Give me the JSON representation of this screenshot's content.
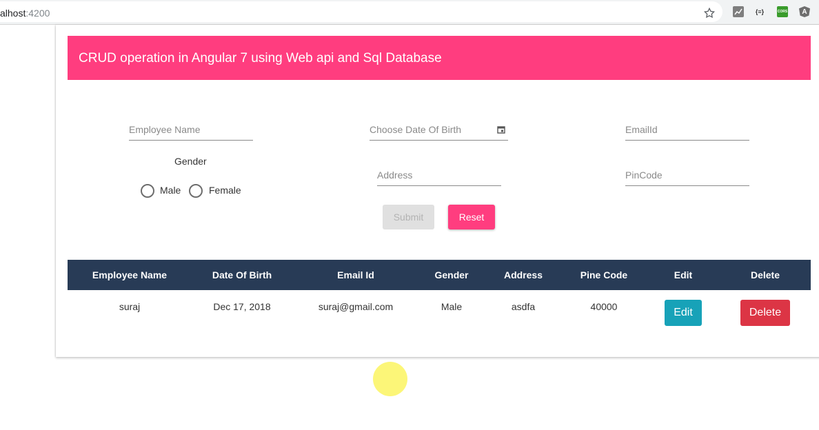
{
  "browser": {
    "url_host": "alhost",
    "url_port": ":4200",
    "extensions": [
      {
        "name": "chart-extension-icon",
        "color": "#7e7e7e",
        "glyph": ""
      },
      {
        "name": "json-extension-icon",
        "color": "#ffffff",
        "glyph": "{≡}"
      },
      {
        "name": "cors-extension-icon",
        "color": "#3a9c2c",
        "glyph": "CORS"
      },
      {
        "name": "angular-extension-icon",
        "color": "#6e6e6e",
        "glyph": "A"
      }
    ]
  },
  "header": {
    "title": "CRUD operation in Angular 7 using Web api and Sql Database",
    "color": "#ff3d7f"
  },
  "form": {
    "employee_name_placeholder": "Employee Name",
    "dob_placeholder": "Choose Date Of Birth",
    "email_placeholder": "EmailId",
    "gender_label": "Gender",
    "gender_options": [
      "Male",
      "Female"
    ],
    "address_placeholder": "Address",
    "pincode_placeholder": "PinCode",
    "submit_label": "Submit",
    "reset_label": "Reset"
  },
  "table": {
    "headers": [
      "Employee Name",
      "Date Of Birth",
      "Email Id",
      "Gender",
      "Address",
      "Pine Code",
      "Edit",
      "Delete"
    ],
    "rows": [
      {
        "name": "suraj",
        "dob": "Dec 17, 2018",
        "email": "suraj@gmail.com",
        "gender": "Male",
        "address": "asdfa",
        "pincode": "40000",
        "edit_label": "Edit",
        "delete_label": "Delete"
      }
    ],
    "header_color": "#283b56"
  }
}
